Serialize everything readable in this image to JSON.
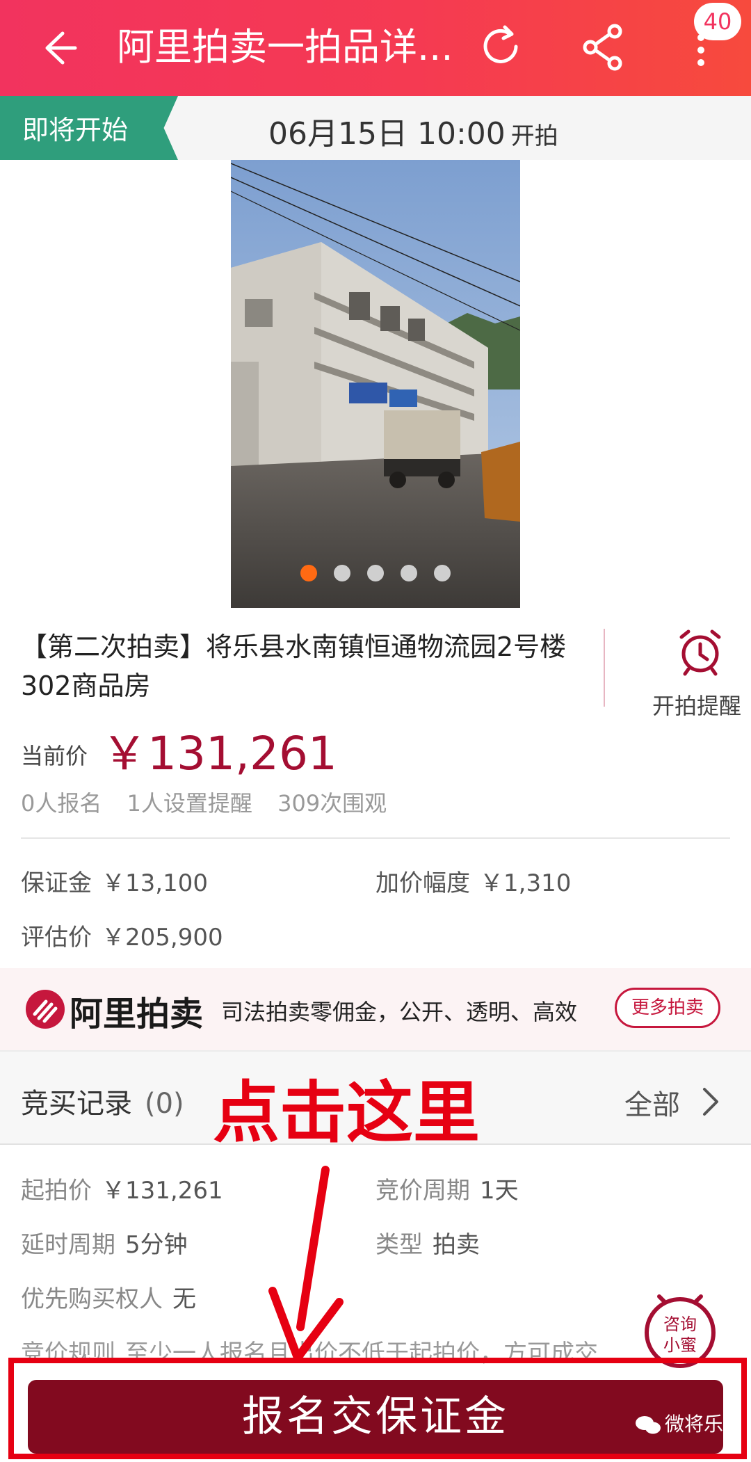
{
  "app_bar": {
    "title": "阿里拍卖一拍品详...",
    "badge_count": "40",
    "icons": [
      "back-arrow-icon",
      "refresh-icon",
      "share-icon",
      "more-icon"
    ]
  },
  "status_strip": {
    "tag": "即将开始",
    "start_time": "06月15日 10:00",
    "start_suffix": "开拍"
  },
  "gallery": {
    "total": 5,
    "active_index": 0
  },
  "item": {
    "title": "【第二次拍卖】将乐县水南镇恒通物流园2号楼302商品房",
    "reminder_label": "开拍提醒",
    "current_price_label": "当前价",
    "current_price": "￥131,261",
    "stats": {
      "signups": "0人报名",
      "reminders": "1人设置提醒",
      "views": "309次围观"
    },
    "deposit_label": "保证金",
    "deposit_value": "￥13,100",
    "increment_label": "加价幅度",
    "increment_value": "￥1,310",
    "appraisal_label": "评估价",
    "appraisal_value": "￥205,900"
  },
  "brand_banner": {
    "name": "阿里拍卖",
    "slogan": "司法拍卖零佣金，公开、透明、高效",
    "more_button": "更多拍卖"
  },
  "records": {
    "label": "竞买记录",
    "count": "(0)",
    "annotation": "点击这里",
    "all_link": "全部"
  },
  "details": {
    "start_price_label": "起拍价",
    "start_price_value": "￥131,261",
    "cycle_label": "竞价周期",
    "cycle_value": "1天",
    "delay_label": "延时周期",
    "delay_value": "5分钟",
    "type_label": "类型",
    "type_value": "拍卖",
    "priority_label": "优先购买权人",
    "priority_value": "无",
    "rule_label": "竞价规则",
    "rule_value": "至少一人报名且出价不低于起拍价，方可成交"
  },
  "consult": {
    "line1": "咨询",
    "line2": "小蜜"
  },
  "cta": {
    "label": "报名交保证金"
  },
  "watermark": "微将乐",
  "colors": {
    "topbar_start": "#f2335e",
    "topbar_end": "#f74a3d",
    "tag_green": "#2f9e7c",
    "price_red": "#a40e32",
    "cta_bg": "#820a1f",
    "annotation_red": "#e60012",
    "active_dot": "#ff6a13"
  }
}
